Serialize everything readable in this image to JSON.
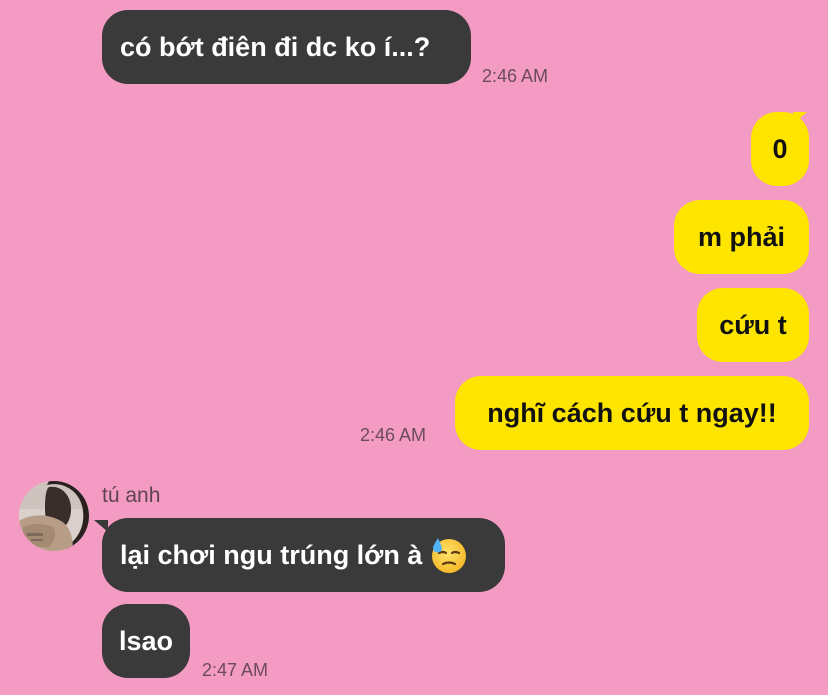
{
  "colors": {
    "background": "#f39bc2",
    "incoming_bubble": "#3a3a3a",
    "outgoing_bubble": "#fee500"
  },
  "messages": [
    {
      "direction": "incoming",
      "text": "có bớt điên đi dc ko í...?",
      "time": "2:46 AM"
    },
    {
      "direction": "outgoing",
      "text": "0"
    },
    {
      "direction": "outgoing",
      "text": "m phải"
    },
    {
      "direction": "outgoing",
      "text": "cứu t"
    },
    {
      "direction": "outgoing",
      "text": "nghĩ cách cứu t ngay!!",
      "time": "2:46 AM"
    },
    {
      "direction": "incoming",
      "sender": "tú anh",
      "avatar": "avatar-photo",
      "text": "lại chơi ngu trúng lớn à",
      "emoji": "downcast-face-with-sweat-icon"
    },
    {
      "direction": "incoming",
      "text": "lsao",
      "time": "2:47 AM"
    }
  ]
}
